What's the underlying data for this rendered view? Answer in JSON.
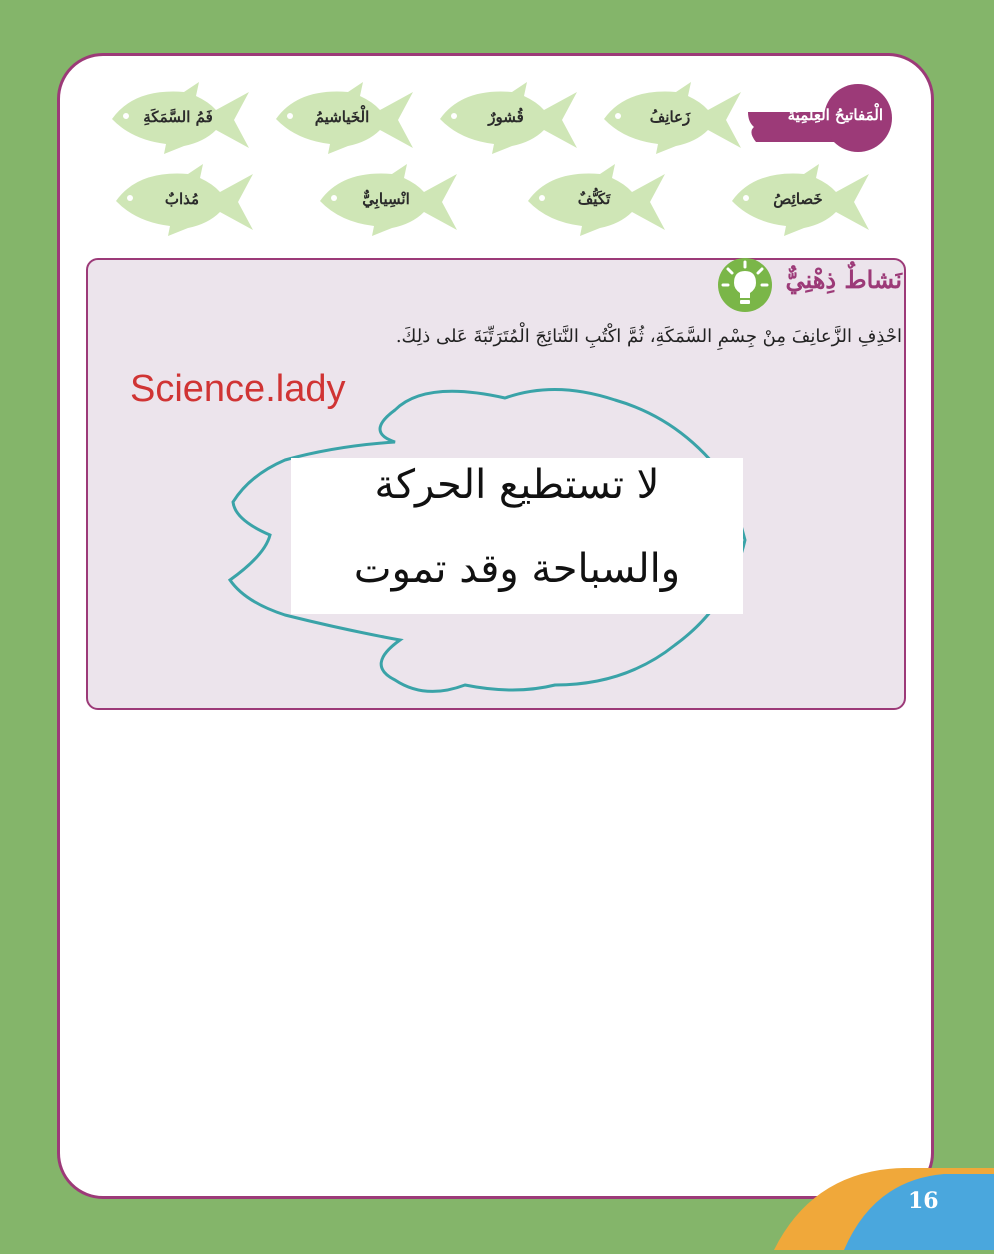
{
  "keywords_title": "الْمَفاتيحُ الْعِلْمِيَّةُ",
  "keywords_row1": [
    "زَعانِفُ",
    "قُشورٌ",
    "الْخَياشيمُ",
    "فَمُ السَّمَكَةِ"
  ],
  "keywords_row2": [
    "خَصائِصُ",
    "تَكَيُّفٌ",
    "انْسِيابِيٌّ",
    "مُذابٌ"
  ],
  "activity": {
    "title": "نَشاطٌ ذِهْنِيٌّ",
    "instruction": "احْذِفِ الزَّعانِفَ مِنْ جِسْمِ السَّمَكَةِ، ثُمَّ اكْتُبِ النَّتائِجَ الْمُتَرَتِّبَةَ عَلى ذلِكَ."
  },
  "watermark": "Science.lady",
  "answer": {
    "line1": "لا تستطيع الحركة",
    "line2": "والسباحة وقد تموت"
  },
  "page_number": "16",
  "colors": {
    "background_green": "#84b56a",
    "border_purple": "#9c3a78",
    "fish_green": "#cfe6b6",
    "outline_teal": "#3aa3a8",
    "watermark_red": "#d03434"
  }
}
